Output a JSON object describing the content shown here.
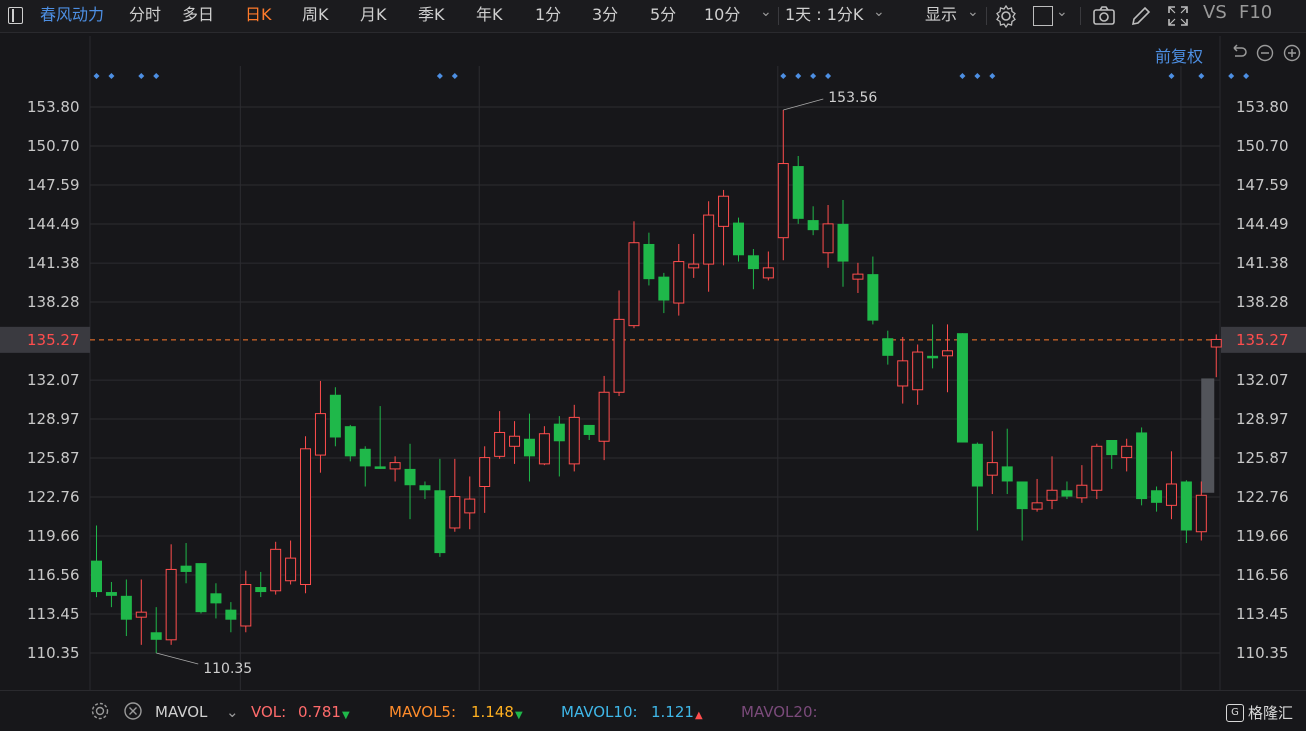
{
  "toolbar": {
    "stock_name": "春风动力",
    "tabs": [
      "分时",
      "多日",
      "日K",
      "周K",
      "月K",
      "季K",
      "年K",
      "1分",
      "3分",
      "5分",
      "10分"
    ],
    "active_tab": "日K",
    "period_select": "1天 : 1分K",
    "display_label": "显示",
    "vs_label": "VS",
    "f10_label": "F10"
  },
  "adjust_label": "前复权",
  "colors": {
    "up": "#ff4d4d",
    "down": "#1fb84a",
    "accent": "#ff7a2b",
    "link": "#4d8fe3",
    "grid": "#2c2c30"
  },
  "chart_data": {
    "type": "candlestick",
    "y_ticks": [
      "153.80",
      "150.70",
      "147.59",
      "144.49",
      "141.38",
      "138.28",
      "135.27",
      "132.07",
      "128.97",
      "125.87",
      "122.76",
      "119.66",
      "116.56",
      "113.45",
      "110.35"
    ],
    "ylim": [
      110.35,
      153.8
    ],
    "current_price": "135.27",
    "max_label": "153.56",
    "min_label": "110.35",
    "max_value": 153.56,
    "min_value": 110.35,
    "candles": [
      [
        117.7,
        115.2,
        120.5,
        114.8
      ],
      [
        115.2,
        114.9,
        116.0,
        114.0
      ],
      [
        114.9,
        113.0,
        116.2,
        111.7
      ],
      [
        113.2,
        113.6,
        116.2,
        111.0
      ],
      [
        112.0,
        111.4,
        114.0,
        110.35
      ],
      [
        111.4,
        117.0,
        119.0,
        111.0
      ],
      [
        117.3,
        116.8,
        119.1,
        115.9
      ],
      [
        117.5,
        113.6,
        117.5,
        113.5
      ],
      [
        115.1,
        114.3,
        115.9,
        113.1
      ],
      [
        113.8,
        113.0,
        114.4,
        112.0
      ],
      [
        112.5,
        115.8,
        116.9,
        112.0
      ],
      [
        115.6,
        115.2,
        116.8,
        114.8
      ],
      [
        115.3,
        118.6,
        119.2,
        115.0
      ],
      [
        116.1,
        117.9,
        119.3,
        115.8
      ],
      [
        115.8,
        126.6,
        127.6,
        115.1
      ],
      [
        126.1,
        129.4,
        132.0,
        124.7
      ],
      [
        130.9,
        127.5,
        131.5,
        126.8
      ],
      [
        128.4,
        126.0,
        128.5,
        125.6
      ],
      [
        126.6,
        125.2,
        126.8,
        123.6
      ],
      [
        125.2,
        125.0,
        130.0,
        125.0
      ],
      [
        125.0,
        125.5,
        126.0,
        124.0
      ],
      [
        125.0,
        123.7,
        127.0,
        121.0
      ],
      [
        123.7,
        123.3,
        124.0,
        122.6
      ],
      [
        123.3,
        118.3,
        125.8,
        118.0
      ],
      [
        120.3,
        122.8,
        125.8,
        120.0
      ],
      [
        121.5,
        122.6,
        124.4,
        120.2
      ],
      [
        123.6,
        125.9,
        126.8,
        121.5
      ],
      [
        126.0,
        127.9,
        129.6,
        125.8
      ],
      [
        126.8,
        127.6,
        128.8,
        125.4
      ],
      [
        127.4,
        126.0,
        129.4,
        124.0
      ],
      [
        125.4,
        127.8,
        128.4,
        125.3
      ],
      [
        128.6,
        127.2,
        129.2,
        124.4
      ],
      [
        125.4,
        129.1,
        130.1,
        124.8
      ],
      [
        128.5,
        127.7,
        128.4,
        127.3
      ],
      [
        127.2,
        131.1,
        132.4,
        125.7
      ],
      [
        131.1,
        136.9,
        139.2,
        130.8
      ],
      [
        136.4,
        143.0,
        144.7,
        136.2
      ],
      [
        142.9,
        140.1,
        143.8,
        139.6
      ],
      [
        140.3,
        138.4,
        140.6,
        137.4
      ],
      [
        138.2,
        141.5,
        142.9,
        137.2
      ],
      [
        141.0,
        141.3,
        143.7,
        140.2
      ],
      [
        141.3,
        145.2,
        146.3,
        139.1
      ],
      [
        144.3,
        146.7,
        147.2,
        141.2
      ],
      [
        144.6,
        142.0,
        145.0,
        141.5
      ],
      [
        142.0,
        140.9,
        142.5,
        139.3
      ],
      [
        140.2,
        141.0,
        142.3,
        140.0
      ],
      [
        143.4,
        149.3,
        153.56,
        141.6
      ],
      [
        149.1,
        144.9,
        149.9,
        144.5
      ],
      [
        144.8,
        144.0,
        145.9,
        143.6
      ],
      [
        142.2,
        144.5,
        146.0,
        141.0
      ],
      [
        144.5,
        141.5,
        146.4,
        139.5
      ],
      [
        140.1,
        140.5,
        141.4,
        139.0
      ],
      [
        140.5,
        136.8,
        141.9,
        136.5
      ],
      [
        135.4,
        134.0,
        136.0,
        133.3
      ],
      [
        131.6,
        133.6,
        135.5,
        130.2
      ],
      [
        131.3,
        134.3,
        134.9,
        130.1
      ],
      [
        134.0,
        133.8,
        136.5,
        133.0
      ],
      [
        134.0,
        134.4,
        136.5,
        131.1
      ],
      [
        135.8,
        127.1,
        135.8,
        127.1
      ],
      [
        127.0,
        123.6,
        127.1,
        120.1
      ],
      [
        124.5,
        125.5,
        128.0,
        123.0
      ],
      [
        125.2,
        124.0,
        128.2,
        123.0
      ],
      [
        124.0,
        121.8,
        124.0,
        119.3
      ],
      [
        121.8,
        122.3,
        124.2,
        121.6
      ],
      [
        122.5,
        123.3,
        126.0,
        121.8
      ],
      [
        123.3,
        122.8,
        124.0,
        122.6
      ],
      [
        122.7,
        123.7,
        125.3,
        122.3
      ],
      [
        123.3,
        126.8,
        127.0,
        122.6
      ],
      [
        127.3,
        126.1,
        127.3,
        125.0
      ],
      [
        125.9,
        126.8,
        127.4,
        124.8
      ],
      [
        127.9,
        122.6,
        128.3,
        122.1
      ],
      [
        123.3,
        122.3,
        123.6,
        121.6
      ],
      [
        122.1,
        123.8,
        126.4,
        121.0
      ],
      [
        124.0,
        120.1,
        124.1,
        119.1
      ],
      [
        120.0,
        122.9,
        124.0,
        119.3
      ],
      [
        134.7,
        135.3,
        135.7,
        132.3
      ]
    ],
    "x_gridlines_at": [
      10,
      26,
      46,
      73
    ]
  },
  "top_markers": [
    0,
    1,
    3,
    4,
    23,
    24,
    46,
    47,
    48,
    49,
    58,
    59,
    60,
    72,
    74,
    76,
    77
  ],
  "volume_bar": {
    "mavol_label": "MAVOL",
    "vol_label": "VOL:",
    "vol_value": "0.781",
    "vol_trend": "down",
    "mavol5_label": "MAVOL5:",
    "mavol5_value": "1.148",
    "mavol5_trend": "down",
    "mavol10_label": "MAVOL10:",
    "mavol10_value": "1.121",
    "mavol10_trend": "up",
    "mavol20_label": "MAVOL20:"
  },
  "logo_text": "格隆汇"
}
